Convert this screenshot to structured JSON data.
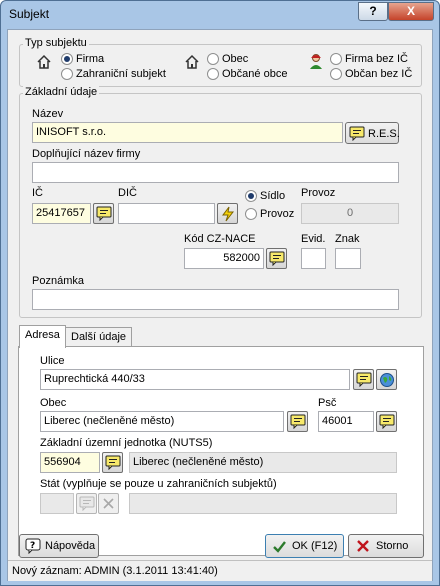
{
  "window": {
    "title": "Subjekt",
    "help_glyph": "?",
    "close_glyph": "X"
  },
  "typ": {
    "title": "Typ subjektu",
    "firma": "Firma",
    "zahranicni": "Zahraniční subjekt",
    "obec": "Obec",
    "obcane_obce": "Občané obce",
    "firma_bez_ic": "Firma bez IČ",
    "obcan_bez_ic": "Občan bez IČ"
  },
  "zakladni": {
    "title": "Základní údaje",
    "nazev_label": "Název",
    "nazev_value": "INISOFT s.r.o.",
    "res_label": "R.E.S.",
    "doplnujici_label": "Doplňující název firmy",
    "doplnujici_value": "",
    "ic_label": "IČ",
    "ic_value": "25417657",
    "dic_label": "DIČ",
    "dic_value": "",
    "sidlo": "Sídlo",
    "provoz": "Provoz",
    "provozovna_label": "Provoz",
    "provozovna_value": "0",
    "nace_label": "Kód CZ-NACE",
    "nace_value": "582000",
    "evid_label": "Evid.",
    "evid_value": "",
    "znak_label": "Znak",
    "znak_value": "",
    "poznamka_label": "Poznámka",
    "poznamka_value": ""
  },
  "tabs": {
    "adresa": "Adresa",
    "dalsi": "Další údaje"
  },
  "adresa": {
    "ulice_label": "Ulice",
    "ulice_value": "Ruprechtická 440/33",
    "obec_label": "Obec",
    "obec_value": "Liberec (nečleněné město)",
    "psc_label": "Psč",
    "psc_value": "46001",
    "nuts_label": "Základní územní jednotka (NUTS5)",
    "nuts_code": "556904",
    "nuts_name": "Liberec (nečleněné město)",
    "stat_label": "Stát (vyplňuje se pouze u zahraničních subjektů)",
    "stat_code": "",
    "stat_name": ""
  },
  "buttons": {
    "napoveda": "Nápověda",
    "ok": "OK (F12)",
    "storno": "Storno"
  },
  "status": "Nový záznam: ADMIN (3.1.2011 13:41:40)",
  "colors": {
    "accent_yellow": "#fefde0",
    "ok_check": "#2c7a2c",
    "storno_x": "#c0141c"
  }
}
